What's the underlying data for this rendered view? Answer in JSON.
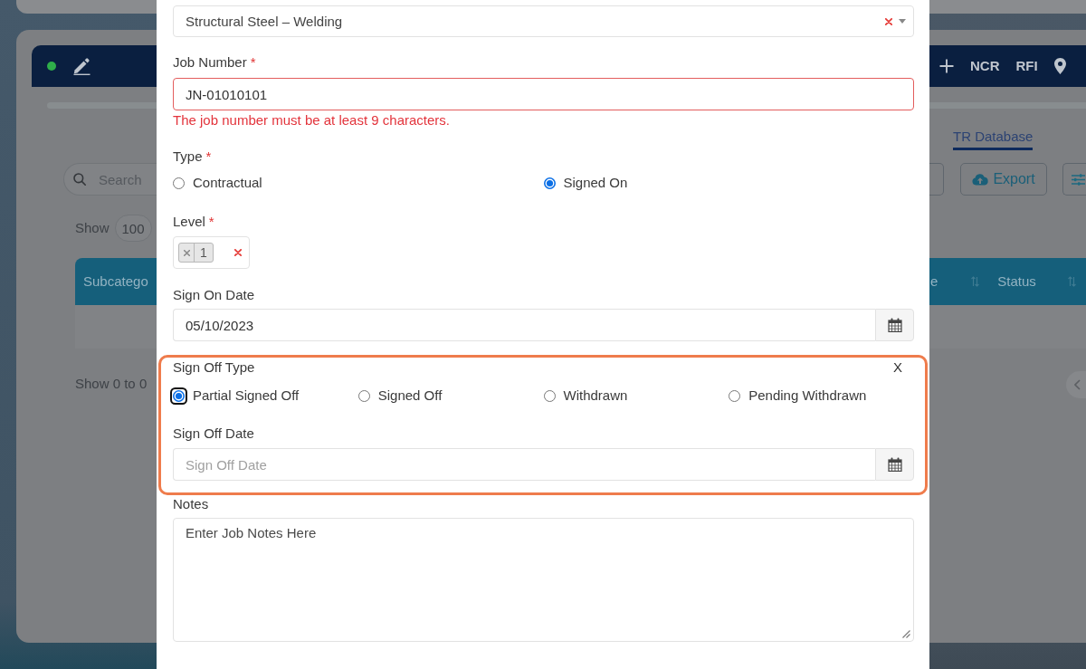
{
  "page": {
    "navbar": {
      "links": [
        "NCR",
        "RFI"
      ]
    },
    "tabs": [
      {
        "label": "TR Database",
        "selected": true
      }
    ],
    "search": {
      "placeholder": "Search"
    },
    "export_button": "Export",
    "page_size": {
      "label": "Show",
      "value": "100"
    },
    "table": {
      "columns": [
        "Subcatego",
        "e",
        "Status"
      ],
      "summary": "Show 0 to 0"
    }
  },
  "job_form": {
    "category": {
      "value": "Structural Steel – Welding"
    },
    "job_number": {
      "label": "Job Number",
      "required_mark": "*",
      "value": "JN-01010101",
      "error": "The job number must be at least 9 characters."
    },
    "type": {
      "label": "Type",
      "required_mark": "*",
      "options": [
        {
          "label": "Contractual",
          "selected": false
        },
        {
          "label": "Signed On",
          "selected": true
        }
      ]
    },
    "level": {
      "label": "Level",
      "required_mark": "*",
      "tags": [
        "1"
      ]
    },
    "sign_on_date": {
      "label": "Sign On Date",
      "value": "05/10/2023"
    },
    "sign_off": {
      "highlighted": true,
      "label": "Sign Off Type",
      "close_label": "X",
      "options": [
        {
          "label": "Partial Signed Off",
          "selected": true,
          "focused": true
        },
        {
          "label": "Signed Off",
          "selected": false,
          "focused": false
        },
        {
          "label": "Withdrawn",
          "selected": false,
          "focused": false
        },
        {
          "label": "Pending Withdrawn",
          "selected": false,
          "focused": false
        }
      ],
      "date": {
        "label": "Sign Off Date",
        "placeholder": "Sign Off Date"
      }
    },
    "notes": {
      "label": "Notes",
      "placeholder": "Enter Job Notes Here"
    }
  }
}
